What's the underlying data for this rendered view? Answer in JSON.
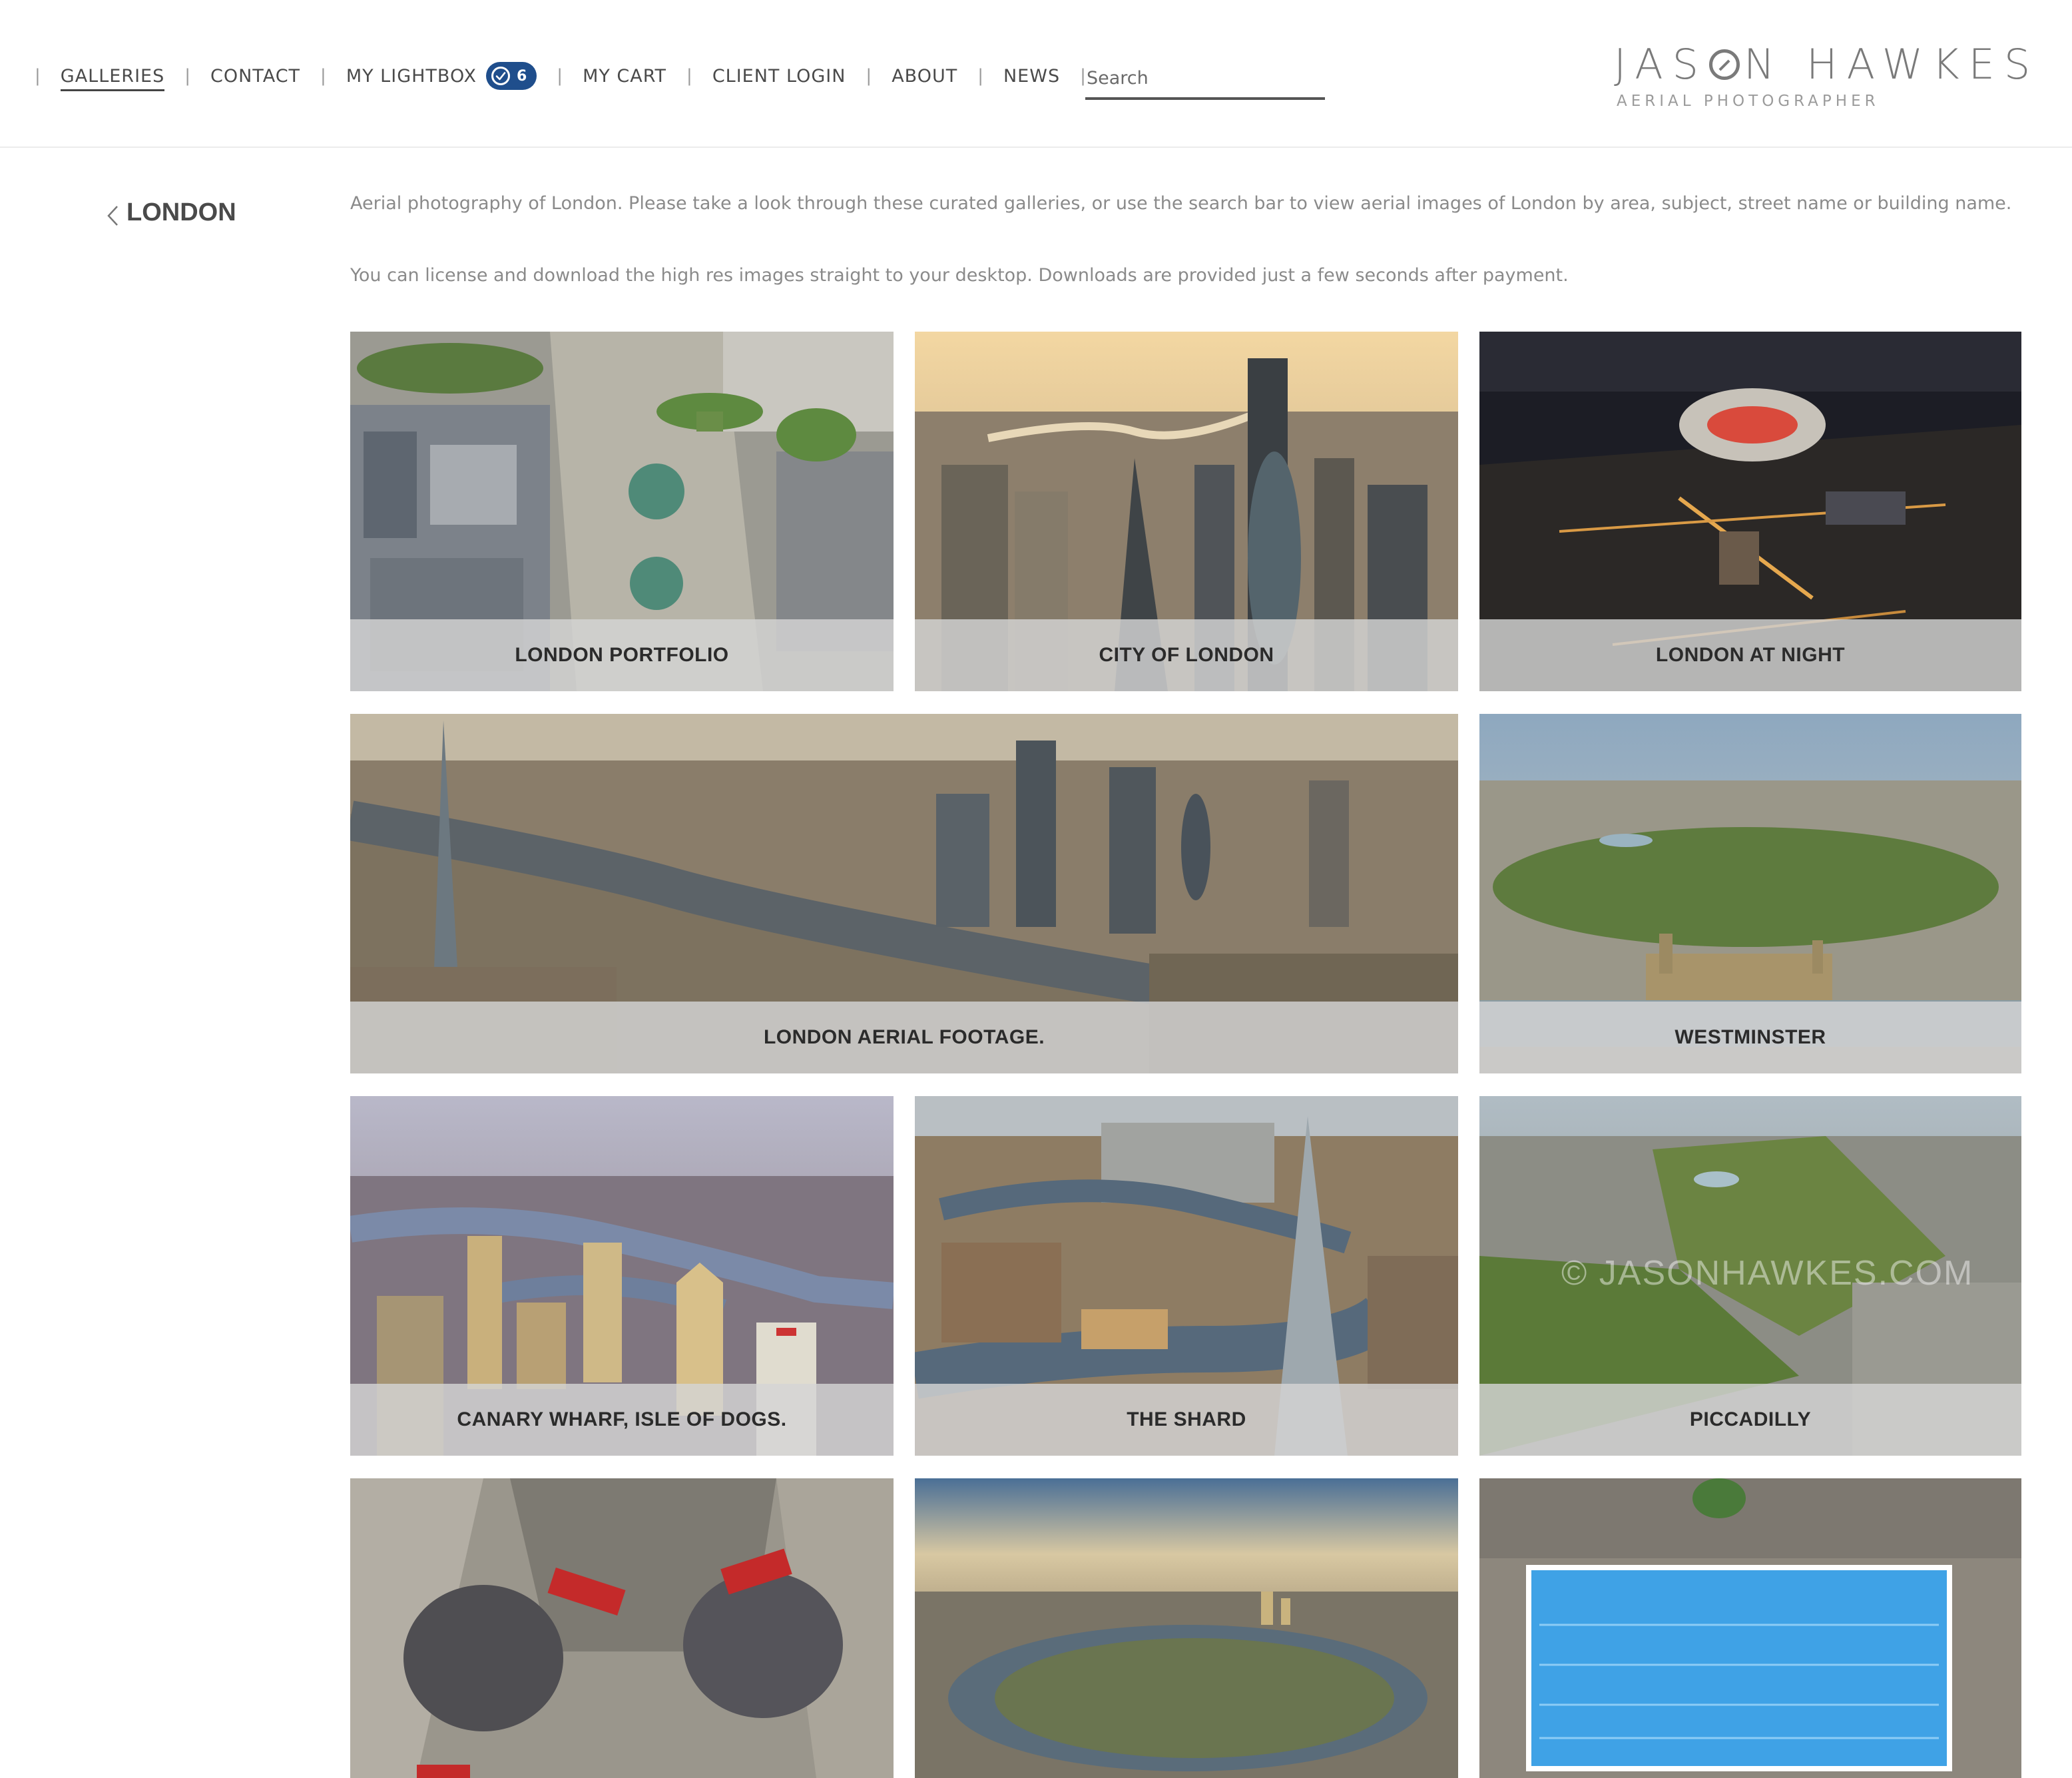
{
  "nav": {
    "items": [
      {
        "label": "GALLERIES"
      },
      {
        "label": "CONTACT"
      },
      {
        "label": "MY LIGHTBOX"
      },
      {
        "label": "MY CART"
      },
      {
        "label": "CLIENT LOGIN"
      },
      {
        "label": "ABOUT"
      },
      {
        "label": "NEWS"
      }
    ],
    "lightbox_count": "6",
    "search_placeholder": "Search"
  },
  "brand": {
    "name_part1": "JAS",
    "name_part2": "N HAWKES",
    "subtitle": "AERIAL PHOTOGRAPHER"
  },
  "page": {
    "title": "LONDON",
    "intro_1": "Aerial photography of London. Please take a look through these curated galleries, or use the search bar to view aerial images of London by area, subject, street name or building name.",
    "intro_2": "You can license and download the high res images straight to your desktop. Downloads are provided just a few seconds after payment."
  },
  "galleries": [
    {
      "title": "LONDON PORTFOLIO"
    },
    {
      "title": "CITY OF LONDON"
    },
    {
      "title": "LONDON AT NIGHT"
    },
    {
      "title": "LONDON AERIAL FOOTAGE."
    },
    {
      "title": "WESTMINSTER"
    },
    {
      "title": "CANARY WHARF, ISLE OF DOGS."
    },
    {
      "title": "THE SHARD"
    },
    {
      "title": "PICCADILLY"
    }
  ],
  "watermark": "© JASONHAWKES.COM",
  "colors": {
    "badge": "#1f4e8c",
    "caption_bg": "#d4d4d4",
    "pool": "#3fa2e6"
  }
}
